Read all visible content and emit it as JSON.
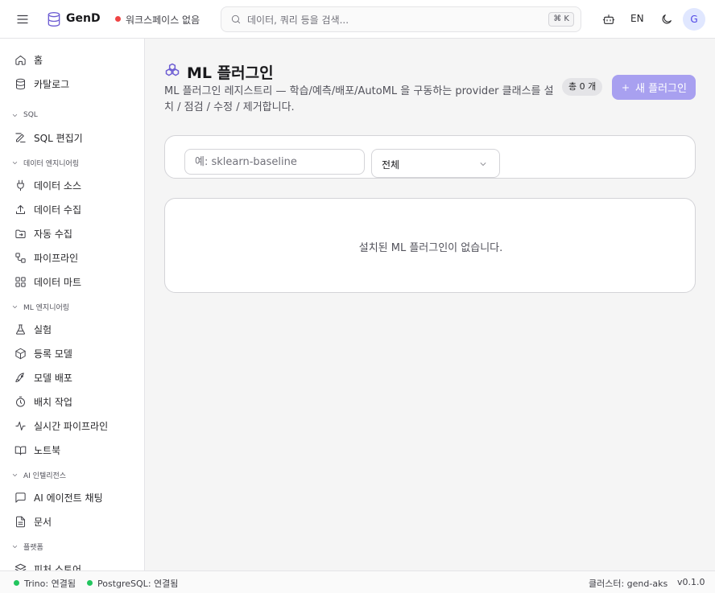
{
  "header": {
    "app_name": "GenD",
    "workspace_status": "워크스페이스 없음",
    "search_placeholder": "데이터, 쿼리 등을 검색...",
    "search_shortcut": "⌘ K",
    "lang": "EN",
    "avatar_initial": "G"
  },
  "sidebar": {
    "items_top": [
      "홈",
      "카탈로그"
    ],
    "sections": [
      {
        "title": "SQL",
        "items": [
          "SQL 편집기"
        ]
      },
      {
        "title": "데이터 엔지니어링",
        "items": [
          "데이터 소스",
          "데이터 수집",
          "자동 수집",
          "파이프라인",
          "데이터 마트"
        ]
      },
      {
        "title": "ML 엔지니어링",
        "items": [
          "실험",
          "등록 모델",
          "모델 배포",
          "배치 작업",
          "실시간 파이프라인",
          "노트북"
        ]
      },
      {
        "title": "AI 인텔리전스",
        "items": [
          "AI 에이전트 채팅",
          "문서"
        ]
      },
      {
        "title": "플랫폼",
        "items": [
          "피처 스토어"
        ]
      }
    ]
  },
  "main": {
    "title": "ML 플러그인",
    "description": "ML 플러그인 레지스트리 — 학습/예측/배포/AutoML 을 구동하는 provider 클래스를 설치 / 점검 / 수정 / 제거합니다.",
    "count_label": "총 0 개",
    "new_button": "새 플러그인",
    "filter_placeholder": "예: sklearn-baseline",
    "filter_select_value": "전체",
    "empty_message": "설치된 ML 플러그인이 없습니다."
  },
  "statusbar": {
    "trino": "Trino: 연결됨",
    "postgres": "PostgreSQL: 연결됨",
    "cluster": "클러스터: gend-aks",
    "version": "v0.1.0"
  },
  "colors": {
    "accent": "#6d5dd3",
    "button_bg": "#a8a0f0",
    "status_ok": "#22c55e",
    "status_error": "#ef4444"
  }
}
